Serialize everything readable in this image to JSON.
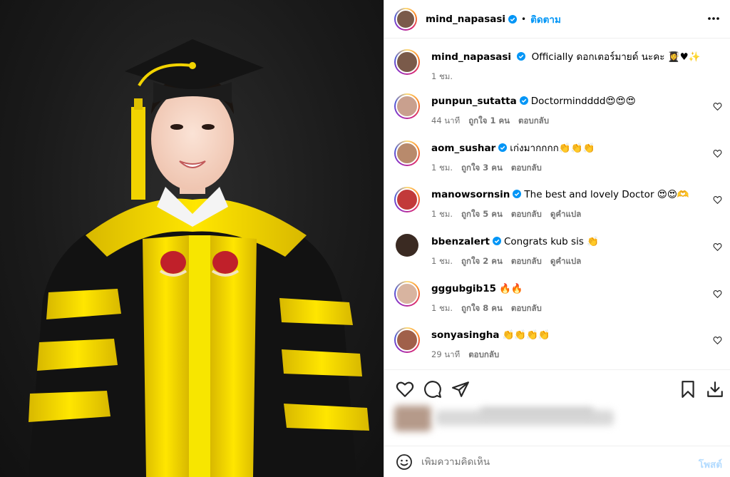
{
  "post": {
    "author": "mind_napasasi",
    "follow_label": "ติดตาม",
    "dot": "•"
  },
  "caption": {
    "username": "mind_napasasi",
    "text": "Officially ดอกเตอร์มายด์ นะคะ 👩‍🎓♥✨",
    "time": "1 ชม."
  },
  "comments": [
    {
      "username": "punpun_sutatta",
      "text": "Doctormindddd😍😍😍",
      "time": "44 นาที",
      "likes": "ถูกใจ 1 คน",
      "reply": "ตอบกลับ",
      "translate": ""
    },
    {
      "username": "aom_sushar",
      "text": "เก่งมากกกก👏👏👏",
      "time": "1 ชม.",
      "likes": "ถูกใจ 3 คน",
      "reply": "ตอบกลับ",
      "translate": ""
    },
    {
      "username": "manowsornsin",
      "text": "The best and lovely Doctor 😍😍🫶",
      "time": "1 ชม.",
      "likes": "ถูกใจ 5 คน",
      "reply": "ตอบกลับ",
      "translate": "ดูคำแปล"
    },
    {
      "username": "bbenzalert",
      "text": "Congrats kub sis 👏",
      "time": "1 ชม.",
      "likes": "ถูกใจ 2 คน",
      "reply": "ตอบกลับ",
      "translate": "ดูคำแปล"
    },
    {
      "username": "gggubgib15",
      "text": "🔥🔥",
      "time": "1 ชม.",
      "likes": "ถูกใจ 8 คน",
      "reply": "ตอบกลับ",
      "translate": ""
    },
    {
      "username": "sonyasingha",
      "text": "👏👏👏👏",
      "time": "29 นาที",
      "likes": "",
      "reply": "ตอบกลับ",
      "translate": ""
    }
  ],
  "add_comment": {
    "placeholder": "เพิ่มความคิดเห็น",
    "post_label": "โพสต์"
  },
  "icons": {
    "verified": "verified-badge-icon",
    "more": "more-options-icon",
    "like": "heart-icon",
    "comment": "comment-icon",
    "share": "share-icon",
    "save": "bookmark-icon",
    "download": "download-icon",
    "emoji": "emoji-icon"
  },
  "colors": {
    "accent": "#0095f6",
    "verified": "#0095f6",
    "muted": "#737373",
    "post_disabled": "#b3dbff",
    "gown_yellow": "#f2d300",
    "gown_black": "#111111"
  }
}
